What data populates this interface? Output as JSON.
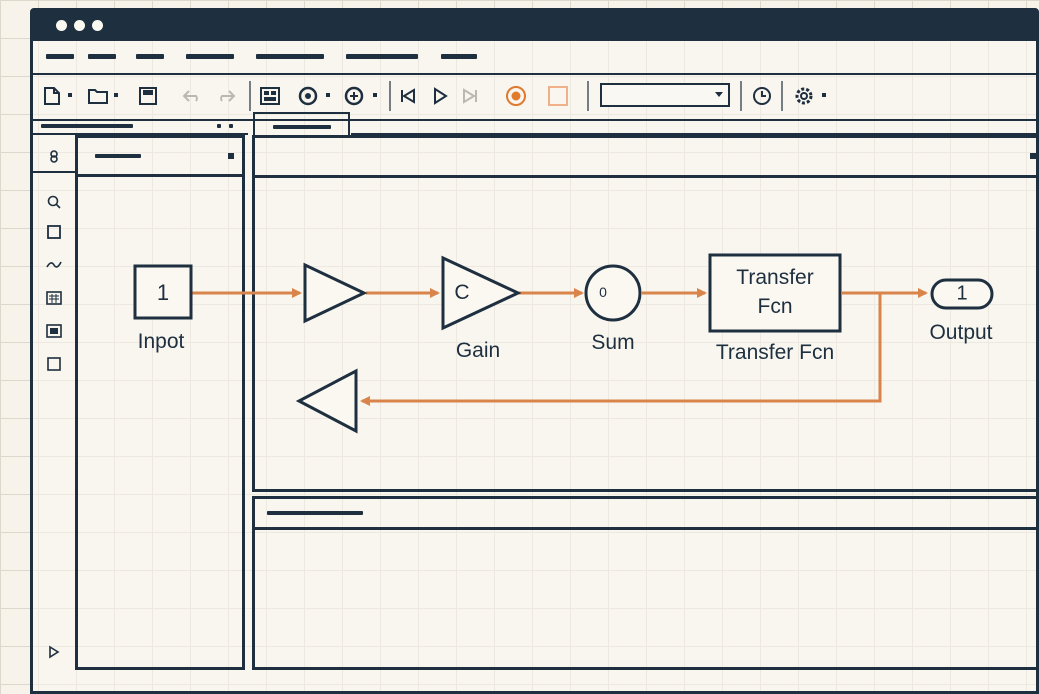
{
  "colors": {
    "frame": "#1e2f40",
    "signal": "#d9844a",
    "background": "#f7f3ea",
    "record_button": "#e07a2e"
  },
  "toolbar": {
    "icons": [
      "new-model-icon",
      "open-icon",
      "save-icon",
      "undo-icon",
      "redo-icon",
      "library-browser-icon",
      "model-settings-icon",
      "target-icon",
      "step-back-icon",
      "run-icon",
      "step-forward-icon",
      "record-icon",
      "stop-icon",
      "stop-time-field",
      "clock-icon",
      "settings-icon"
    ]
  },
  "diagram": {
    "inport": {
      "label": "Inpot",
      "number": "1"
    },
    "gain_in": {},
    "gain": {
      "label": "Gain",
      "value": "C"
    },
    "sum": {
      "label": "Sum",
      "glyph": "0"
    },
    "transfer_fcn": {
      "label": "Transfer Fcn",
      "line1": "Transfer",
      "line2": "Fcn"
    },
    "outport": {
      "label": "Output",
      "number": "1"
    },
    "feedback_gain": {}
  }
}
